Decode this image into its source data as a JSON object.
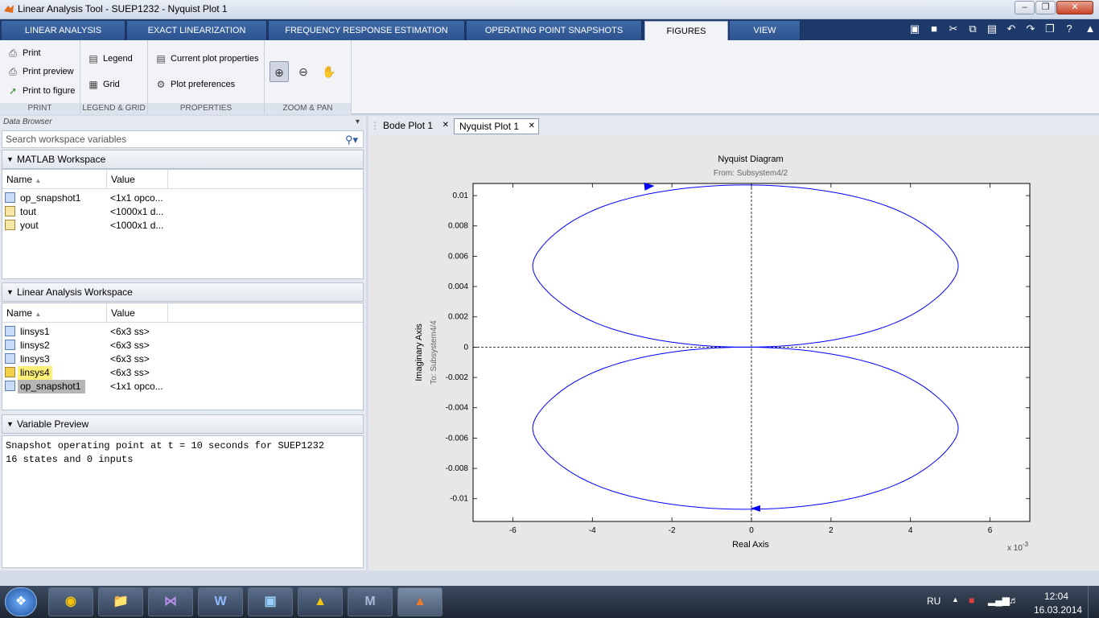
{
  "window": {
    "title": "Linear Analysis Tool - SUEP1232 - Nyquist Plot 1"
  },
  "ribbon_tabs": [
    {
      "label": "LINEAR ANALYSIS"
    },
    {
      "label": "EXACT LINEARIZATION"
    },
    {
      "label": "FREQUENCY RESPONSE ESTIMATION"
    },
    {
      "label": "OPERATING POINT SNAPSHOTS"
    },
    {
      "label": "FIGURES"
    },
    {
      "label": "VIEW"
    }
  ],
  "ribbon": {
    "print": {
      "print": "Print",
      "preview": "Print preview",
      "to_figure": "Print to figure",
      "group": "PRINT"
    },
    "legend_grid": {
      "legend": "Legend",
      "grid": "Grid",
      "group": "LEGEND & GRID"
    },
    "properties": {
      "current": "Current plot properties",
      "prefs": "Plot preferences",
      "group": "PROPERTIES"
    },
    "zoom": {
      "group": "ZOOM & PAN"
    }
  },
  "data_browser": {
    "title": "Data Browser",
    "search_placeholder": "Search workspace variables",
    "matlab_ws": {
      "title": "MATLAB Workspace",
      "col_name": "Name",
      "col_value": "Value",
      "rows": [
        {
          "name": "op_snapshot1",
          "value": "<1x1 opco..."
        },
        {
          "name": "tout",
          "value": "<1000x1 d..."
        },
        {
          "name": "yout",
          "value": "<1000x1 d..."
        }
      ]
    },
    "linear_ws": {
      "title": "Linear Analysis Workspace",
      "col_name": "Name",
      "col_value": "Value",
      "rows": [
        {
          "name": "linsys1",
          "value": "<6x3 ss>"
        },
        {
          "name": "linsys2",
          "value": "<6x3 ss>"
        },
        {
          "name": "linsys3",
          "value": "<6x3 ss>"
        },
        {
          "name": "linsys4",
          "value": "<6x3 ss>"
        },
        {
          "name": "op_snapshot1",
          "value": "<1x1 opco..."
        }
      ]
    },
    "preview": {
      "title": "Variable Preview",
      "text": "Snapshot operating point at t = 10 seconds for SUEP1232\n16 states and 0 inputs"
    }
  },
  "doc_tabs": [
    {
      "label": "Bode Plot 1"
    },
    {
      "label": "Nyquist Plot 1"
    }
  ],
  "chart_data": {
    "type": "line",
    "title": "Nyquist Diagram",
    "subtitle": "From: Subsystem4/2",
    "xlabel": "Real Axis",
    "ylabel": "Imaginary Axis",
    "ylabel2": "To: Subsystem4/4",
    "x_exponent": "x 10",
    "x_exponent_power": "-3",
    "xlim": [
      -7,
      7
    ],
    "ylim": [
      -0.0115,
      0.0108
    ],
    "xticks": [
      "-6",
      "-4",
      "-2",
      "0",
      "2",
      "4",
      "6"
    ],
    "xtick_values": [
      -6,
      -4,
      -2,
      0,
      2,
      4,
      6
    ],
    "yticks": [
      "0.01",
      "0.008",
      "0.006",
      "0.004",
      "0.002",
      "0",
      "-0.002",
      "-0.004",
      "-0.006",
      "-0.008",
      "-0.01"
    ],
    "ytick_values": [
      0.01,
      0.008,
      0.006,
      0.004,
      0.002,
      0,
      -0.002,
      -0.004,
      -0.006,
      -0.008,
      -0.01
    ],
    "curve_color": "#0000ff",
    "upper_loop": {
      "left": -5.5,
      "right": 5.2,
      "top": 0.0107,
      "bottom": 0
    },
    "lower_loop": {
      "left": -5.5,
      "right": 5.2,
      "top": 0,
      "bottom": -0.0107
    }
  },
  "taskbar": {
    "apps": [
      "chrome-icon",
      "explorer-icon",
      "visual-studio-icon",
      "word-icon",
      "photo-icon",
      "simulink-icon",
      "matlab-m-icon",
      "matlab-icon"
    ],
    "lang": "RU",
    "time": "12:04",
    "date": "16.03.2014"
  }
}
